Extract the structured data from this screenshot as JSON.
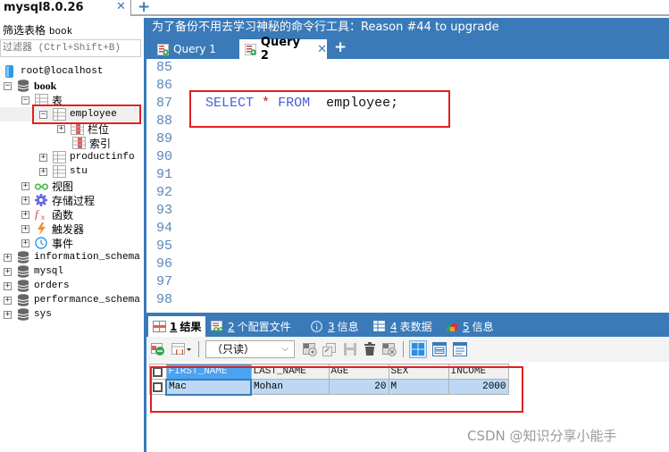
{
  "connection": {
    "tab_title": "mysql8.0.26",
    "close_icon": "close-icon",
    "add_icon": "plus-icon"
  },
  "sidebar": {
    "filter_label": "筛选表格",
    "filter_value": "book",
    "filter_placeholder": "过滤器 (Ctrl+Shift+B)",
    "tree": [
      {
        "label": "root@localhost",
        "icon": "server-icon",
        "level": 0,
        "expander": null
      },
      {
        "label": "book",
        "icon": "database-icon",
        "level": 0,
        "expander": "minus"
      },
      {
        "label": "表",
        "icon": "tables-icon",
        "level": 1,
        "expander": "minus"
      },
      {
        "label": "employee",
        "icon": "table-icon",
        "level": 2,
        "expander": "minus",
        "selected": true
      },
      {
        "label": "栏位",
        "icon": "columns-icon",
        "level": 3,
        "expander": "plus"
      },
      {
        "label": "索引",
        "icon": "index-icon",
        "level": 3,
        "expander": null
      },
      {
        "label": "productinfo",
        "icon": "table-icon",
        "level": 2,
        "expander": "plus"
      },
      {
        "label": "stu",
        "icon": "table-icon",
        "level": 2,
        "expander": "plus"
      },
      {
        "label": "视图",
        "icon": "view-icon",
        "level": 1,
        "expander": "plus"
      },
      {
        "label": "存储过程",
        "icon": "gear-icon",
        "level": 1,
        "expander": "plus"
      },
      {
        "label": "函数",
        "icon": "function-icon",
        "level": 1,
        "expander": "plus"
      },
      {
        "label": "触发器",
        "icon": "lightning-icon",
        "level": 1,
        "expander": "plus"
      },
      {
        "label": "事件",
        "icon": "clock-icon",
        "level": 1,
        "expander": "plus"
      },
      {
        "label": "information_schema",
        "icon": "database-icon",
        "level": 0,
        "expander": "plus"
      },
      {
        "label": "mysql",
        "icon": "database-icon",
        "level": 0,
        "expander": "plus"
      },
      {
        "label": "orders",
        "icon": "database-icon",
        "level": 0,
        "expander": "plus"
      },
      {
        "label": "performance_schema",
        "icon": "database-icon",
        "level": 0,
        "expander": "plus"
      },
      {
        "label": "sys",
        "icon": "database-icon",
        "level": 0,
        "expander": "plus"
      }
    ]
  },
  "editor": {
    "promo": "为了备份不用去学习神秘的命令行工具：Reason #44 to upgrade",
    "tabs": [
      {
        "label": "Query 1",
        "active": false
      },
      {
        "label": "Query 2",
        "active": true
      }
    ],
    "line_numbers": [
      "85",
      "86",
      "87",
      "88",
      "89",
      "90",
      "91",
      "92",
      "93",
      "94",
      "95",
      "96",
      "97",
      "98"
    ],
    "code": {
      "kw1": "SELECT",
      "star": "*",
      "kw2": "FROM",
      "ident": "employee;"
    }
  },
  "results": {
    "tabs": [
      {
        "num": "1",
        "label": "结果",
        "icon": "result-grid-icon",
        "active": true
      },
      {
        "num": "2",
        "label": "个配置文件",
        "icon": "profile-icon"
      },
      {
        "num": "3",
        "label": "信息",
        "icon": "info-icon"
      },
      {
        "num": "4",
        "label": "表数据",
        "icon": "table-data-icon"
      },
      {
        "num": "5",
        "label": "信息",
        "icon": "info-shapes-icon"
      }
    ],
    "readonly_select": "（只读）",
    "columns": [
      "FIRST_NAME",
      "LAST_NAME",
      "AGE",
      "SEX",
      "INCOME"
    ],
    "rows": [
      [
        "Mac",
        "Mohan",
        "20",
        "M",
        "2000"
      ]
    ]
  },
  "watermark": "CSDN @知识分享小能手",
  "colors": {
    "accent": "#3a7ab8",
    "highlight_box": "#e02020",
    "keyword": "#4a5fd8",
    "line_number": "#5a87b8"
  }
}
